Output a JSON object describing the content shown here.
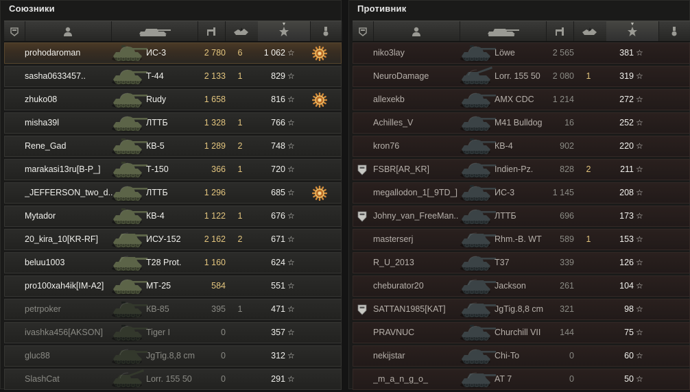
{
  "allies": {
    "title": "Союзники",
    "players": [
      {
        "name": "prohodaroman",
        "tank": "ИС-3",
        "damage": "2 780",
        "kills": "6",
        "xp": "1 062",
        "medal": true,
        "self": true,
        "dead": false,
        "tier": "heavy"
      },
      {
        "name": "sasha0633457..",
        "tank": "Т-44",
        "damage": "2 133",
        "kills": "1",
        "xp": "829",
        "medal": false,
        "self": false,
        "dead": false,
        "tier": "medium"
      },
      {
        "name": "zhuko08",
        "tank": "Rudy",
        "damage": "1 658",
        "kills": "",
        "xp": "816",
        "medal": true,
        "self": false,
        "dead": false,
        "tier": "medium"
      },
      {
        "name": "misha39l",
        "tank": "ЛТТБ",
        "damage": "1 328",
        "kills": "1",
        "xp": "766",
        "medal": false,
        "self": false,
        "dead": false,
        "tier": "light"
      },
      {
        "name": "Rene_Gad",
        "tank": "КВ-5",
        "damage": "1 289",
        "kills": "2",
        "xp": "748",
        "medal": false,
        "self": false,
        "dead": false,
        "tier": "heavy"
      },
      {
        "name": "marakasi13ru[B-P_]",
        "tank": "Т-150",
        "damage": "366",
        "kills": "1",
        "xp": "720",
        "medal": false,
        "self": false,
        "dead": false,
        "tier": "heavy"
      },
      {
        "name": "_JEFFERSON_two_d..",
        "tank": "ЛТТБ",
        "damage": "1 296",
        "kills": "",
        "xp": "685",
        "medal": true,
        "self": false,
        "dead": false,
        "tier": "light"
      },
      {
        "name": "Mytador",
        "tank": "КВ-4",
        "damage": "1 122",
        "kills": "1",
        "xp": "676",
        "medal": false,
        "self": false,
        "dead": false,
        "tier": "heavy"
      },
      {
        "name": "20_kira_10[KR-RF]",
        "tank": "ИСУ-152",
        "damage": "2 162",
        "kills": "2",
        "xp": "671",
        "medal": false,
        "self": false,
        "dead": false,
        "tier": "td"
      },
      {
        "name": "beluu1003",
        "tank": "T28 Prot.",
        "damage": "1 160",
        "kills": "",
        "xp": "624",
        "medal": false,
        "self": false,
        "dead": false,
        "tier": "td"
      },
      {
        "name": "pro100xah4ik[IM-A2]",
        "tank": "МТ-25",
        "damage": "584",
        "kills": "",
        "xp": "551",
        "medal": false,
        "self": false,
        "dead": false,
        "tier": "light"
      },
      {
        "name": "petrpoker",
        "tank": "КВ-85",
        "damage": "395",
        "kills": "1",
        "xp": "471",
        "medal": false,
        "self": false,
        "dead": true,
        "tier": "heavy"
      },
      {
        "name": "ivashka456[AKSON]",
        "tank": "Tiger I",
        "damage": "0",
        "kills": "",
        "xp": "357",
        "medal": false,
        "self": false,
        "dead": true,
        "tier": "heavy"
      },
      {
        "name": "gluc88",
        "tank": "JgTig.8,8 cm",
        "damage": "0",
        "kills": "",
        "xp": "312",
        "medal": false,
        "self": false,
        "dead": true,
        "tier": "td"
      },
      {
        "name": "SlashCat",
        "tank": "Lorr. 155 50",
        "damage": "0",
        "kills": "",
        "xp": "291",
        "medal": false,
        "self": false,
        "dead": true,
        "tier": "spg"
      }
    ]
  },
  "enemies": {
    "title": "Противник",
    "players": [
      {
        "name": "niko3lay",
        "tank": "Löwe",
        "damage": "2 565",
        "kills": "",
        "xp": "381",
        "platoon": false,
        "tier": "heavy"
      },
      {
        "name": "NeuroDamage",
        "tank": "Lorr. 155 50",
        "damage": "2 080",
        "kills": "1",
        "xp": "319",
        "platoon": false,
        "tier": "spg"
      },
      {
        "name": "allexekb",
        "tank": "AMX CDC",
        "damage": "1 214",
        "kills": "",
        "xp": "272",
        "platoon": false,
        "tier": "medium"
      },
      {
        "name": "Achilles_V",
        "tank": "M41 Bulldog",
        "damage": "16",
        "kills": "",
        "xp": "252",
        "platoon": false,
        "tier": "light"
      },
      {
        "name": "kron76",
        "tank": "КВ-4",
        "damage": "902",
        "kills": "",
        "xp": "220",
        "platoon": false,
        "tier": "heavy"
      },
      {
        "name": "FSBR[AR_KR]",
        "tank": "Indien-Pz.",
        "damage": "828",
        "kills": "2",
        "xp": "211",
        "platoon": true,
        "tier": "medium"
      },
      {
        "name": "megallodon_1[_9TD_]",
        "tank": "ИС-3",
        "damage": "1 145",
        "kills": "",
        "xp": "208",
        "platoon": false,
        "tier": "heavy"
      },
      {
        "name": "Johny_van_FreeMan..",
        "tank": "ЛТТБ",
        "damage": "696",
        "kills": "",
        "xp": "173",
        "platoon": true,
        "tier": "light"
      },
      {
        "name": "masterserj",
        "tank": "Rhm.-B. WT",
        "damage": "589",
        "kills": "1",
        "xp": "153",
        "platoon": false,
        "tier": "td"
      },
      {
        "name": "R_U_2013",
        "tank": "T37",
        "damage": "339",
        "kills": "",
        "xp": "126",
        "platoon": false,
        "tier": "light"
      },
      {
        "name": "cheburator20",
        "tank": "Jackson",
        "damage": "261",
        "kills": "",
        "xp": "104",
        "platoon": false,
        "tier": "td"
      },
      {
        "name": "SATTAN1985[KAT]",
        "tank": "JgTig.8,8 cm",
        "damage": "321",
        "kills": "",
        "xp": "98",
        "platoon": true,
        "tier": "td"
      },
      {
        "name": "PRAVNUC",
        "tank": "Churchill VII",
        "damage": "144",
        "kills": "",
        "xp": "75",
        "platoon": false,
        "tier": "heavy"
      },
      {
        "name": "nekijstar",
        "tank": "Chi-To",
        "damage": "0",
        "kills": "",
        "xp": "60",
        "platoon": false,
        "tier": "medium"
      },
      {
        "name": "_m_a_n_g_o_",
        "tank": "AT 7",
        "damage": "0",
        "kills": "",
        "xp": "50",
        "platoon": false,
        "tier": "td"
      }
    ]
  },
  "columns": [
    "platoon-icon",
    "player-icon",
    "tank-icon",
    "damage-icon",
    "kills-icon",
    "xp-star-icon",
    "medal-icon"
  ],
  "star_glyph": "☆",
  "colors": {
    "damage": "#e3c57e",
    "text": "#f0f0ec",
    "dimmed": "#8a8a84",
    "self_row": "#4a3a26"
  }
}
